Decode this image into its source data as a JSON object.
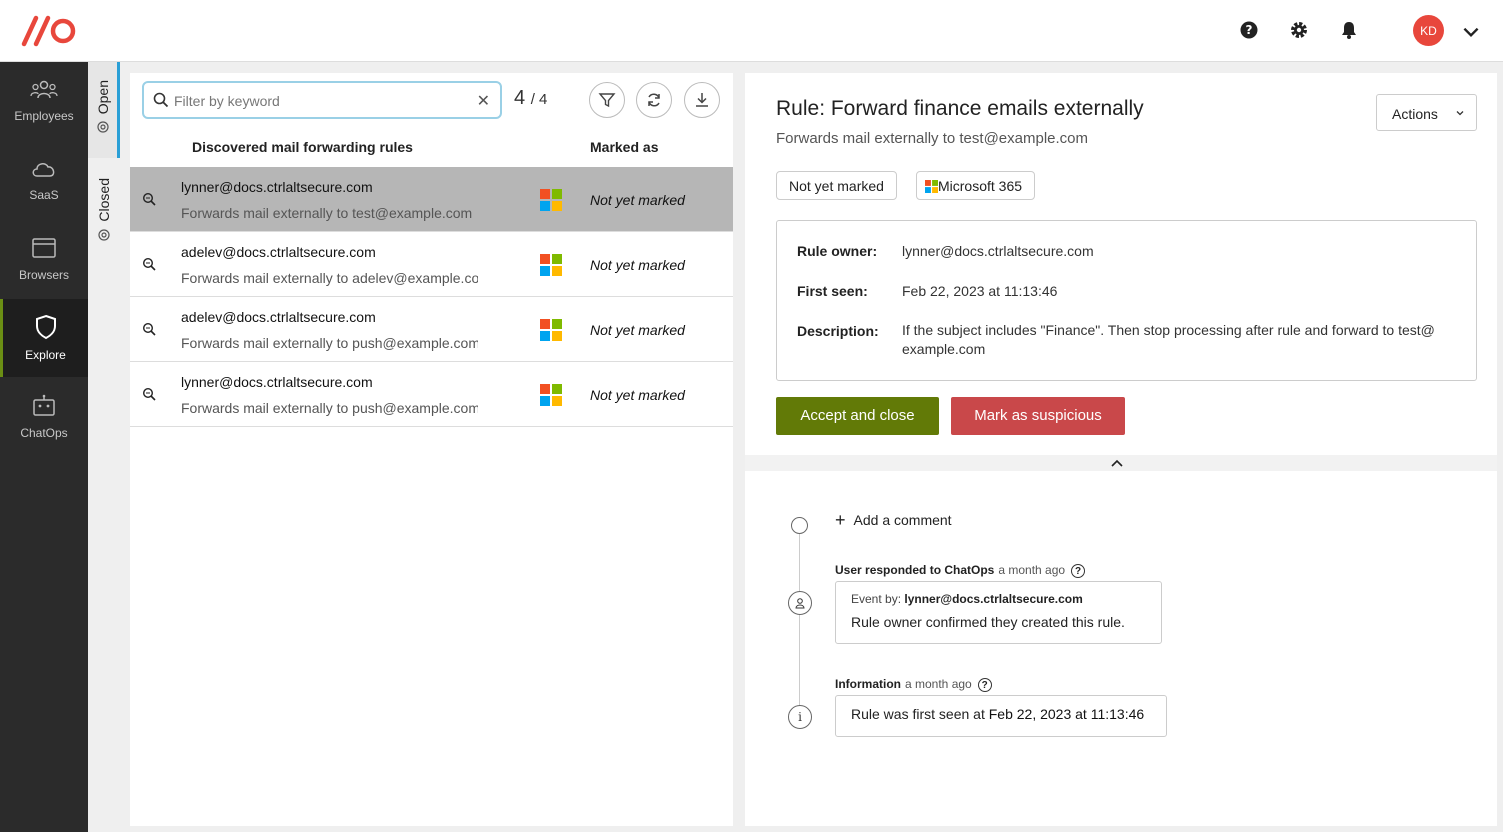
{
  "header": {
    "avatar_initials": "KD"
  },
  "nav": {
    "items": [
      {
        "label": "Employees",
        "icon": "employees-icon"
      },
      {
        "label": "SaaS",
        "icon": "cloud-icon"
      },
      {
        "label": "Browsers",
        "icon": "browser-icon"
      },
      {
        "label": "Explore",
        "icon": "shield-icon"
      },
      {
        "label": "ChatOps",
        "icon": "chatops-icon"
      }
    ],
    "active": "Explore"
  },
  "tabs": {
    "open": "Open",
    "closed": "Closed"
  },
  "list": {
    "search_placeholder": "Filter by keyword",
    "count_shown": "4",
    "count_total": "/ 4",
    "col_rules": "Discovered mail forwarding rules",
    "col_marked": "Marked as",
    "rows": [
      {
        "email": "lynner@docs.ctrlaltsecure.com",
        "desc": "Forwards mail externally to test@example.com",
        "mark": "Not yet marked"
      },
      {
        "email": "adelev@docs.ctrlaltsecure.com",
        "desc": "Forwards mail externally to adelev@example.com",
        "mark": "Not yet marked"
      },
      {
        "email": "adelev@docs.ctrlaltsecure.com",
        "desc": "Forwards mail externally to push@example.com",
        "mark": "Not yet marked"
      },
      {
        "email": "lynner@docs.ctrlaltsecure.com",
        "desc": "Forwards mail externally to push@example.com",
        "mark": "Not yet marked"
      }
    ]
  },
  "detail": {
    "title": "Rule: Forward finance emails externally",
    "subtitle": "Forwards mail externally to test@example.com",
    "actions_label": "Actions",
    "chip_status": "Not yet marked",
    "chip_source": "Microsoft 365",
    "info": {
      "owner_label": "Rule owner:",
      "owner_value": "lynner@docs.ctrlaltsecure.com",
      "first_seen_label": "First seen:",
      "first_seen_value": "Feb 22, 2023 at 11:13:46",
      "description_label": "Description:",
      "description_value": "If the subject includes \"Finance\". Then stop processing after rule and forward to test@ example.com"
    },
    "accept_label": "Accept and close",
    "suspicious_label": "Mark as suspicious",
    "add_comment": "Add a comment",
    "events": [
      {
        "title": "User responded to ChatOps",
        "ago": "a month ago",
        "by_label": "Event by:",
        "by_value": "lynner@docs.ctrlaltsecure.com",
        "message": "Rule owner confirmed they created this rule."
      },
      {
        "title": "Information",
        "ago": "a month ago",
        "message_prefix": "Rule was first seen at ",
        "message_strong": "Feb 22, 2023 at 11:13:46"
      }
    ]
  },
  "colors": {
    "accept": "#627a07",
    "suspicious": "#c9484a",
    "logo": "#e8473c",
    "active_tab": "#2a9fd6"
  }
}
